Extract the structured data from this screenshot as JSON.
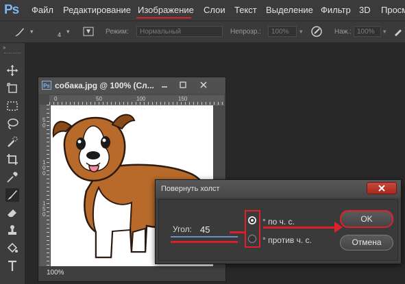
{
  "app": {
    "logo": "Ps"
  },
  "menu": {
    "items": [
      "Файл",
      "Редактирование",
      "Изображение",
      "Слои",
      "Текст",
      "Выделение",
      "Фильтр",
      "3D",
      "Просм"
    ],
    "active_index": 2
  },
  "options_bar": {
    "brush_size": "4",
    "mode_label": "Режим:",
    "mode_value": "Нормальный",
    "opacity_label": "Непрозр.:",
    "opacity_value": "100%",
    "pressure_label": "Наж.:",
    "pressure_value": "100%"
  },
  "toolbar": {
    "tools": [
      "move-icon",
      "artboard-icon",
      "marquee-icon",
      "lasso-icon",
      "quick-select-icon",
      "crop-icon",
      "eyedropper-icon",
      "brush-icon",
      "eraser-icon",
      "stamp-icon",
      "paint-bucket-icon",
      "type-icon"
    ]
  },
  "document": {
    "title": "собака.jpg @ 100% (Сл...",
    "zoom": "100%",
    "ruler_top": [
      "0",
      "50",
      "100",
      "150"
    ],
    "ruler_left": [
      "5",
      "0",
      "1",
      "0",
      "0",
      "1",
      "5",
      "0"
    ]
  },
  "dialog": {
    "title": "Повернуть холст",
    "angle_label": "Угол:",
    "angle_value": "45",
    "cw_label": "° по ч. с.",
    "ccw_label": "° против ч. с.",
    "selected": "cw",
    "ok_label": "OK",
    "cancel_label": "Отмена"
  },
  "colors": {
    "annotation": "#e0212b",
    "ps_blue": "#7fb6f0"
  }
}
